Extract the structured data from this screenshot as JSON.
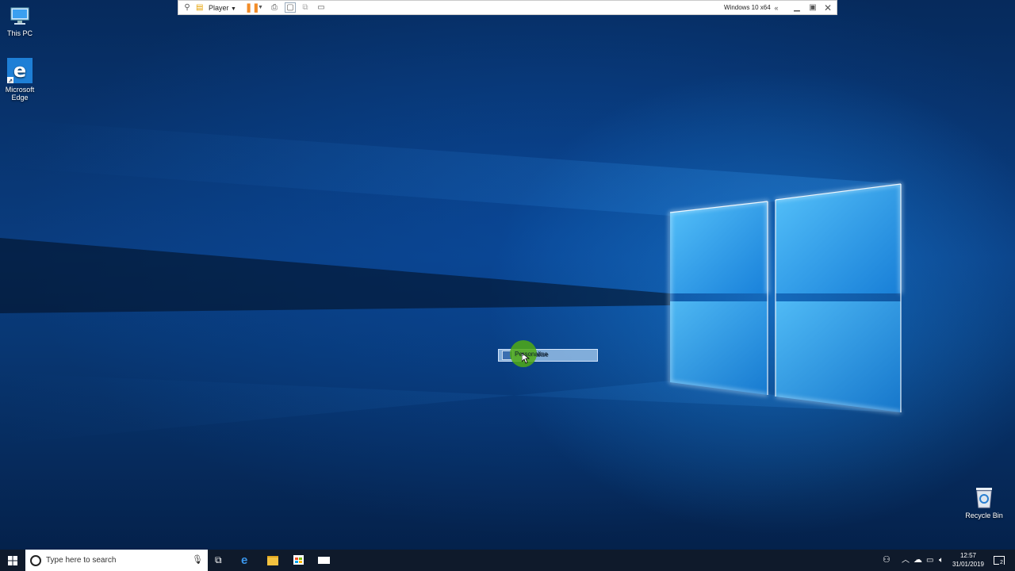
{
  "vm_toolbar": {
    "pin_icon": "pin-icon",
    "player_label": "Player",
    "vm_name": "Windows 10 x64",
    "icons": [
      "pause-icon",
      "send-ctrl-alt-del-icon",
      "fit-guest-icon",
      "unity-icon",
      "full-screen-icon",
      "back-arrows-icon",
      "minimize-icon",
      "restore-icon",
      "close-icon"
    ]
  },
  "desktop": {
    "icons": [
      {
        "label": "This PC",
        "icon": "this-pc-icon"
      },
      {
        "label": "Microsoft Edge",
        "icon": "edge-icon"
      },
      {
        "label": "Recycle Bin",
        "icon": "recycle-bin-icon"
      }
    ]
  },
  "context_menu": {
    "item_label": "Personalise",
    "item_icon": "personalise-icon"
  },
  "taskbar": {
    "search_placeholder": "Type here to search",
    "pinned": [
      "task-view-icon",
      "edge-icon",
      "file-explorer-icon",
      "store-icon",
      "mail-icon"
    ],
    "tray": {
      "time": "12:57",
      "date": "31/01/2019",
      "notification_count": "2",
      "icons": [
        "people-icon",
        "chevron-up-icon",
        "onedrive-icon",
        "network-icon",
        "volume-icon",
        "action-center-icon"
      ]
    }
  },
  "colors": {
    "accent": "#1e8ce6",
    "taskbar": "#0f1a2b",
    "pause": "#f28c28"
  }
}
